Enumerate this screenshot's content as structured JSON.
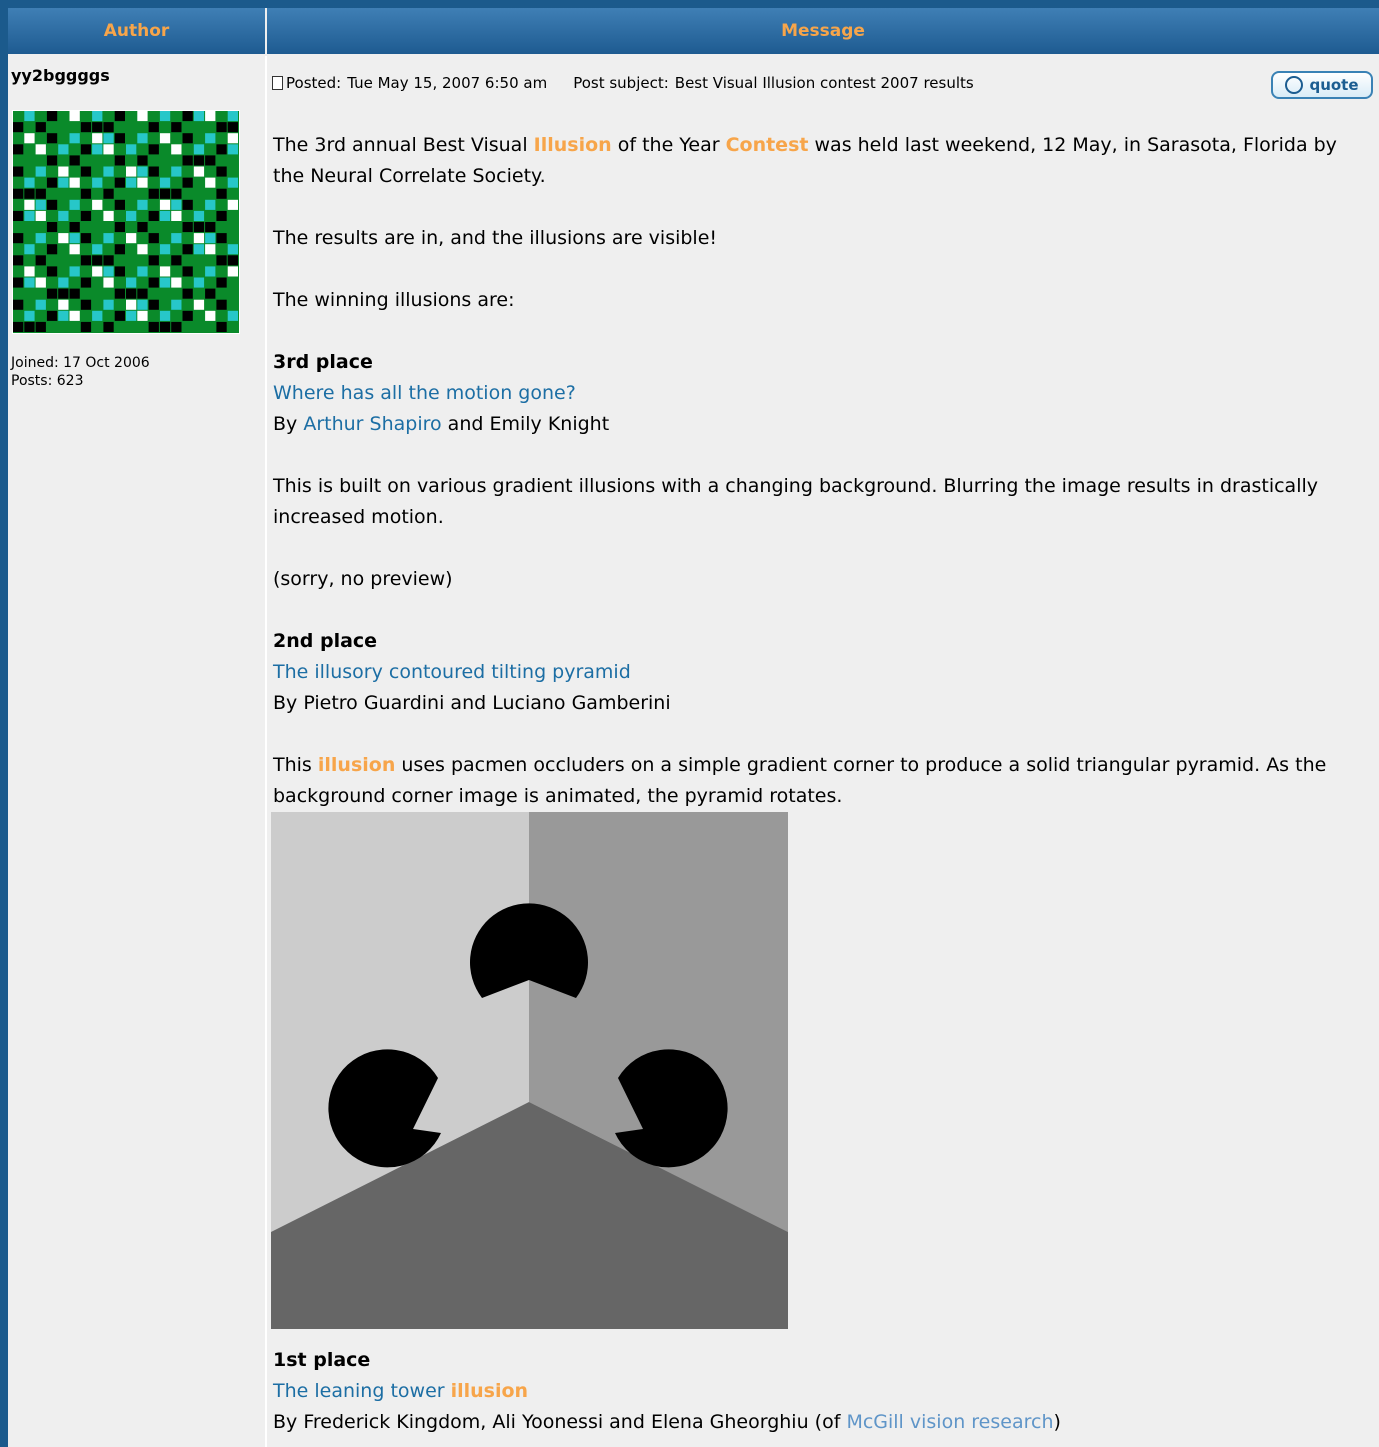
{
  "table": {
    "col_author": "Author",
    "col_message": "Message"
  },
  "author": {
    "username": "yy2bggggs",
    "joined": "Joined: 17 Oct 2006",
    "posts": "Posts: 623"
  },
  "post": {
    "posted_label": "Posted:",
    "posted_date": "Tue May 15, 2007 6:50 am",
    "subject_label": "Post subject:",
    "subject": "Best Visual Illusion contest 2007 results",
    "quote_label": "quote",
    "p1": {
      "a": "The 3rd annual Best Visual ",
      "hl1": "Illusion",
      "b": " of the Year ",
      "hl2": "Contest",
      "c": " was held last weekend, 12 May, in Sarasota, Florida by the Neural Correlate Society."
    },
    "p2": "The results are in, and the illusions are visible!",
    "p3": "The winning illusions are:",
    "third": {
      "place": "3rd place",
      "title": "Where has all the motion gone?",
      "by": "By ",
      "author_link": "Arthur Shapiro",
      "rest": " and Emily Knight",
      "desc": "This is built on various gradient illusions with a changing background. Blurring the image results in drastically increased motion.",
      "note": "(sorry, no preview)"
    },
    "second": {
      "place": "2nd place",
      "title": "The illusory contoured tilting pyramid",
      "by": "By Pietro Guardini and Luciano Gamberini",
      "desc_a": "This ",
      "desc_hl": "illusion",
      "desc_b": " uses pacmen occluders on a simple gradient corner to produce a solid triangular pyramid. As the background corner image is animated, the pyramid rotates."
    },
    "first": {
      "place": "1st place",
      "title_a": "The leaning tower ",
      "title_hl": "illusion",
      "by_a": "By Frederick Kingdom, Ali Yoonessi and Elena Gheorghiu (of ",
      "link": "McGill vision research",
      "by_b": ")"
    }
  }
}
